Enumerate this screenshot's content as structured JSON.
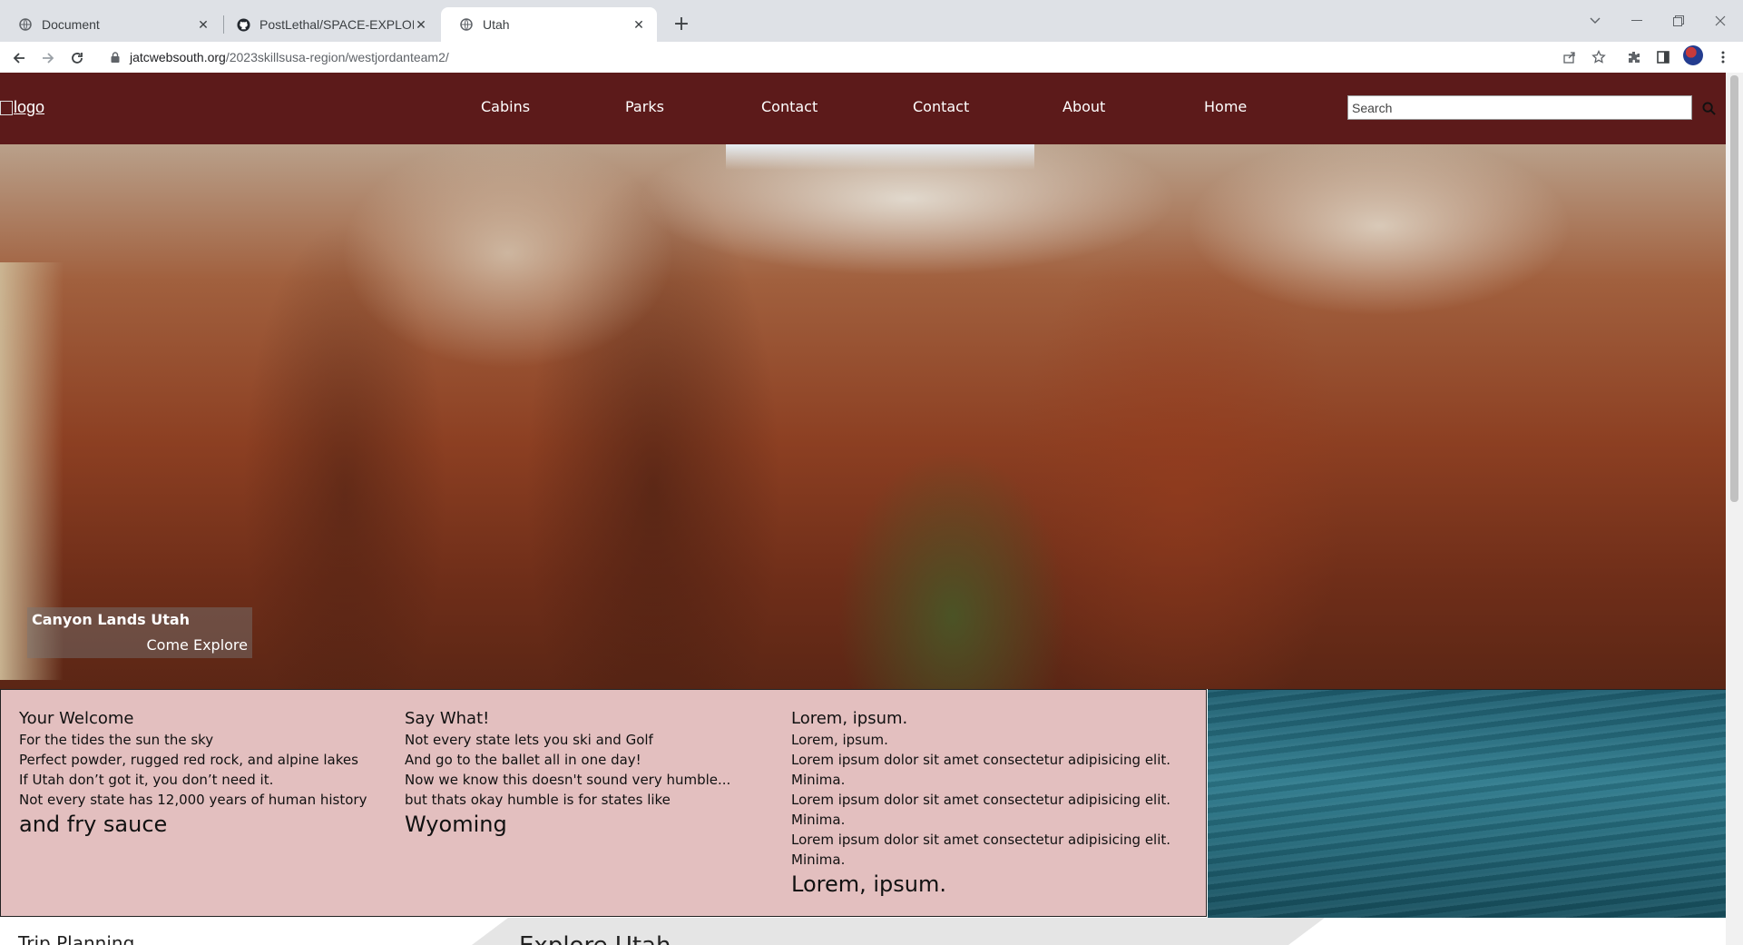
{
  "browser": {
    "tabs": [
      {
        "title": "Document",
        "favicon": "globe-icon",
        "active": false
      },
      {
        "title": "PostLethal/SPACE-EXPLORATION",
        "favicon": "github-icon",
        "active": false
      },
      {
        "title": "Utah",
        "favicon": "globe-icon",
        "active": true
      }
    ],
    "new_tab": "+",
    "url_host": "jatcwebsouth.org",
    "url_path": "/2023skillsusa-region/westjordanteam2/"
  },
  "site": {
    "logo_alt": "logo",
    "nav": [
      "Cabins",
      "Parks",
      "Contact",
      "Contact",
      "About",
      "Home"
    ],
    "search_placeholder": "Search",
    "brand_color": "#5c1a1a"
  },
  "hero": {
    "caption_title": "Canyon Lands Utah",
    "caption_sub": "Come Explore"
  },
  "info": {
    "columns": [
      {
        "heading": "Your Welcome",
        "lines": [
          "For the tides the sun the sky",
          "Perfect powder, rugged red rock, and alpine lakes",
          "If Utah don’t got it, you don’t need it.",
          "Not every state has 12,000 years of human history"
        ],
        "big": "and fry sauce"
      },
      {
        "heading": "Say What!",
        "lines": [
          "Not every state lets you ski and Golf",
          "And go to the ballet all in one day!",
          "Now we know this doesn't sound very humble...",
          "but thats okay humble is for states like"
        ],
        "big": "Wyoming"
      },
      {
        "heading": "Lorem, ipsum.",
        "lines": [
          "Lorem, ipsum.",
          "Lorem ipsum dolor sit amet consectetur adipisicing elit.",
          "Minima.",
          "Lorem ipsum dolor sit amet consectetur adipisicing elit.",
          "Minima.",
          "Lorem ipsum dolor sit amet consectetur adipisicing elit.",
          "Minima."
        ],
        "big": "Lorem, ipsum."
      }
    ],
    "panel_color": "#e3bfbf"
  },
  "bottom": {
    "left_heading": "Trip Planning",
    "center_heading": "Explore Utah"
  }
}
